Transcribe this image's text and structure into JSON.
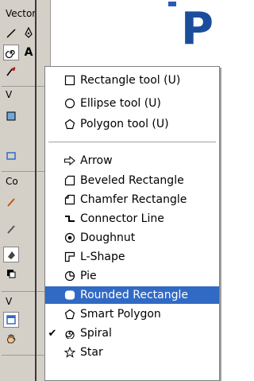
{
  "toolpanel": {
    "section_vector_label": "Vector",
    "section_v1_label": "V",
    "section_c_label": "Co",
    "section_v2_label": "V"
  },
  "menu": {
    "group1": [
      {
        "label": "Rectangle tool (U)",
        "icon": "rectangle-icon"
      },
      {
        "label": "Ellipse tool (U)",
        "icon": "ellipse-icon"
      },
      {
        "label": "Polygon tool (U)",
        "icon": "polygon-icon"
      }
    ],
    "group2": [
      {
        "label": "Arrow",
        "icon": "arrow-icon"
      },
      {
        "label": "Beveled Rectangle",
        "icon": "beveled-rectangle-icon"
      },
      {
        "label": "Chamfer Rectangle",
        "icon": "chamfer-rectangle-icon"
      },
      {
        "label": "Connector Line",
        "icon": "connector-line-icon"
      },
      {
        "label": "Doughnut",
        "icon": "doughnut-icon"
      },
      {
        "label": "L-Shape",
        "icon": "l-shape-icon"
      },
      {
        "label": "Pie",
        "icon": "pie-icon"
      },
      {
        "label": "Rounded Rectangle",
        "icon": "rounded-rectangle-icon",
        "highlighted": true
      },
      {
        "label": "Smart Polygon",
        "icon": "smart-polygon-icon"
      },
      {
        "label": "Spiral",
        "icon": "spiral-icon",
        "checked": true
      },
      {
        "label": "Star",
        "icon": "star-icon"
      }
    ],
    "highlight_color": "#316ac5",
    "check_mark": "✔"
  }
}
